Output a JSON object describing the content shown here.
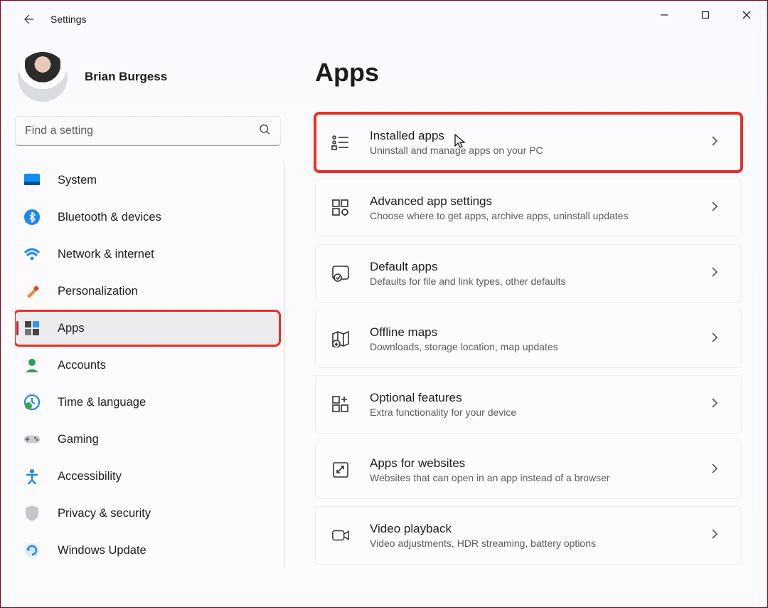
{
  "window": {
    "title": "Settings"
  },
  "user": {
    "name": "Brian Burgess"
  },
  "search": {
    "placeholder": "Find a setting"
  },
  "nav": {
    "items": [
      {
        "label": "System",
        "icon": "system"
      },
      {
        "label": "Bluetooth & devices",
        "icon": "bluetooth"
      },
      {
        "label": "Network & internet",
        "icon": "wifi"
      },
      {
        "label": "Personalization",
        "icon": "brush"
      },
      {
        "label": "Apps",
        "icon": "apps",
        "selected": true,
        "highlight": true
      },
      {
        "label": "Accounts",
        "icon": "account"
      },
      {
        "label": "Time & language",
        "icon": "clock"
      },
      {
        "label": "Gaming",
        "icon": "gaming"
      },
      {
        "label": "Accessibility",
        "icon": "accessibility"
      },
      {
        "label": "Privacy & security",
        "icon": "shield"
      },
      {
        "label": "Windows Update",
        "icon": "update"
      }
    ]
  },
  "page": {
    "title": "Apps",
    "cards": [
      {
        "title": "Installed apps",
        "subtitle": "Uninstall and manage apps on your PC",
        "icon": "installed",
        "highlight": true
      },
      {
        "title": "Advanced app settings",
        "subtitle": "Choose where to get apps, archive apps, uninstall updates",
        "icon": "advanced"
      },
      {
        "title": "Default apps",
        "subtitle": "Defaults for file and link types, other defaults",
        "icon": "default"
      },
      {
        "title": "Offline maps",
        "subtitle": "Downloads, storage location, map updates",
        "icon": "map"
      },
      {
        "title": "Optional features",
        "subtitle": "Extra functionality for your device",
        "icon": "optional"
      },
      {
        "title": "Apps for websites",
        "subtitle": "Websites that can open in an app instead of a browser",
        "icon": "websites"
      },
      {
        "title": "Video playback",
        "subtitle": "Video adjustments, HDR streaming, battery options",
        "icon": "video"
      }
    ]
  }
}
